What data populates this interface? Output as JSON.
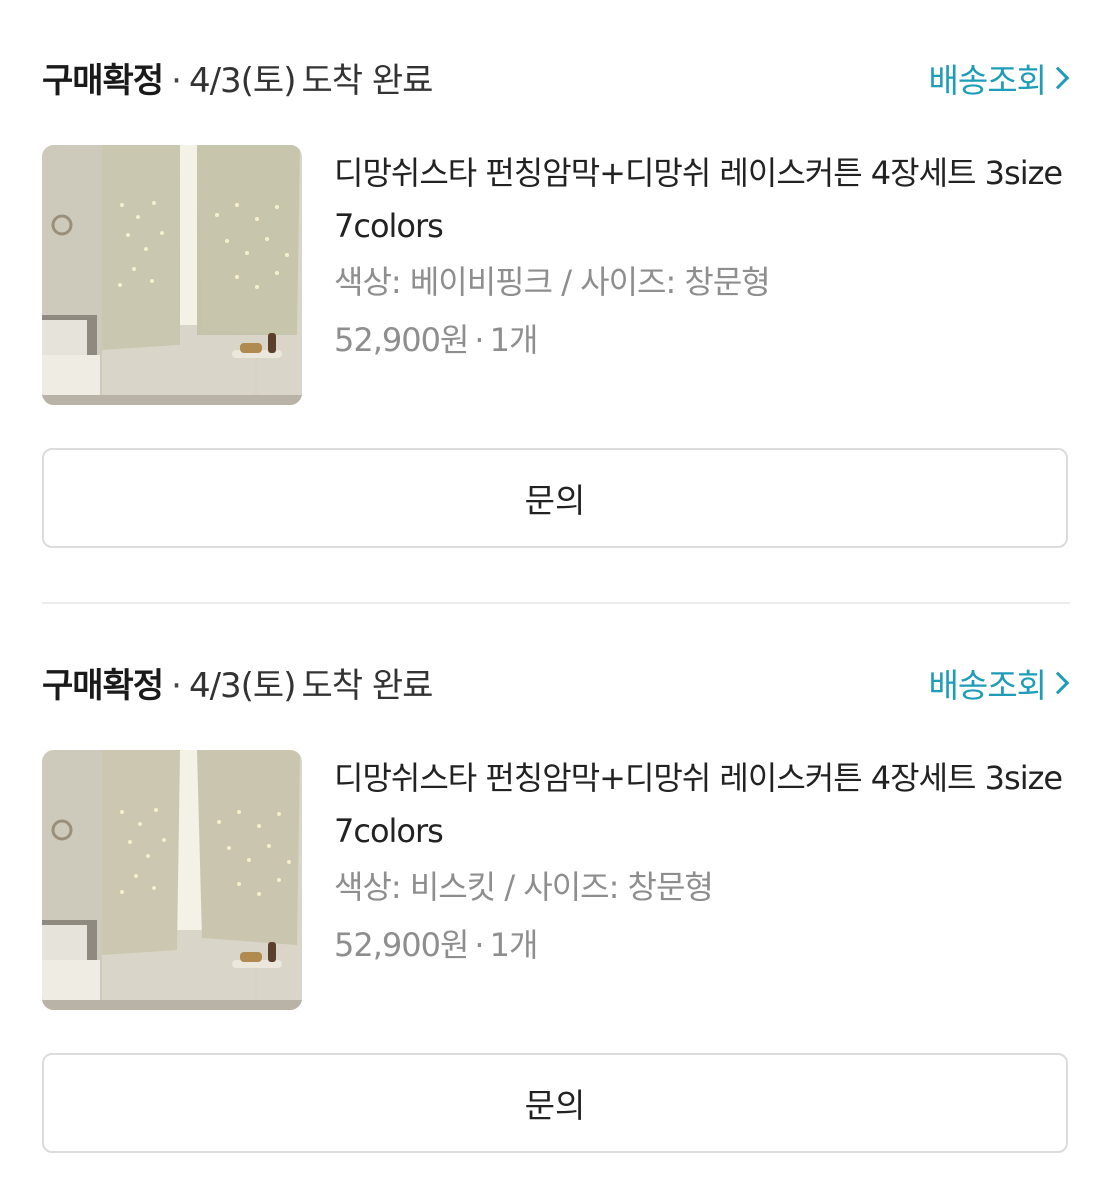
{
  "orders": [
    {
      "status": "구매확정",
      "separator": "·",
      "date": "4/3(토)",
      "arrival": "도착 완료",
      "track_label": "배송조회",
      "product_name": "디망쉬스타 펀칭암막+디망쉬 레이스커튼 4장세트 3size 7colors",
      "option": "색상: 베이비핑크 / 사이즈: 창문형",
      "price": "52,900원",
      "price_separator": "·",
      "quantity": "1개",
      "inquiry_label": "문의"
    },
    {
      "status": "구매확정",
      "separator": "·",
      "date": "4/3(토)",
      "arrival": "도착 완료",
      "track_label": "배송조회",
      "product_name": "디망쉬스타 펀칭암막+디망쉬 레이스커튼 4장세트 3size 7colors",
      "option": "색상: 비스킷 / 사이즈: 창문형",
      "price": "52,900원",
      "price_separator": "·",
      "quantity": "1개",
      "inquiry_label": "문의"
    }
  ],
  "colors": {
    "accent": "#1e9cb8",
    "muted_text": "#8e8e8e",
    "border": "#dcdcdc"
  },
  "icons": {
    "track_chevron": "chevron-right-icon"
  }
}
